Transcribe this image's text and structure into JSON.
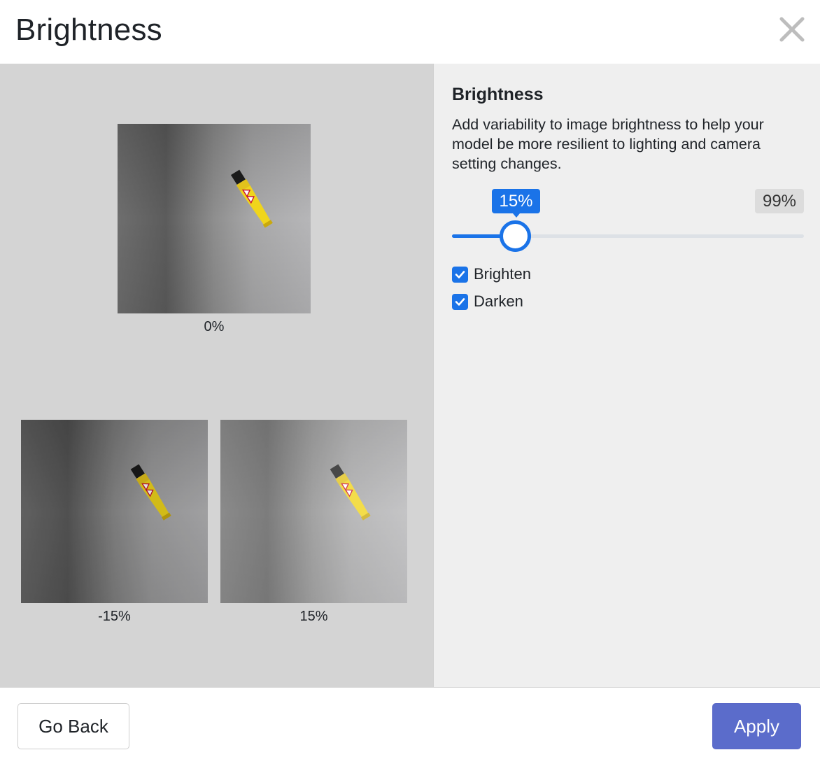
{
  "header": {
    "title": "Brightness",
    "close_icon": "close-icon"
  },
  "preview": {
    "images": [
      {
        "caption": "0%",
        "brightness": 0
      },
      {
        "caption": "-15%",
        "brightness": -15
      },
      {
        "caption": "15%",
        "brightness": 15
      }
    ]
  },
  "settings": {
    "title": "Brightness",
    "description": "Add variability to image brightness to help your model be more resilient to lighting and camera setting changes.",
    "slider": {
      "value_label": "15%",
      "max_label": "99%",
      "value_fraction": 0.15
    },
    "options": [
      {
        "label": "Brighten",
        "checked": true
      },
      {
        "label": "Darken",
        "checked": true
      }
    ]
  },
  "footer": {
    "back_label": "Go Back",
    "apply_label": "Apply"
  },
  "colors": {
    "accent": "#1a73e8",
    "apply": "#5b6ccb",
    "preview_bg": "#d4d4d4",
    "settings_bg": "#efefef"
  }
}
